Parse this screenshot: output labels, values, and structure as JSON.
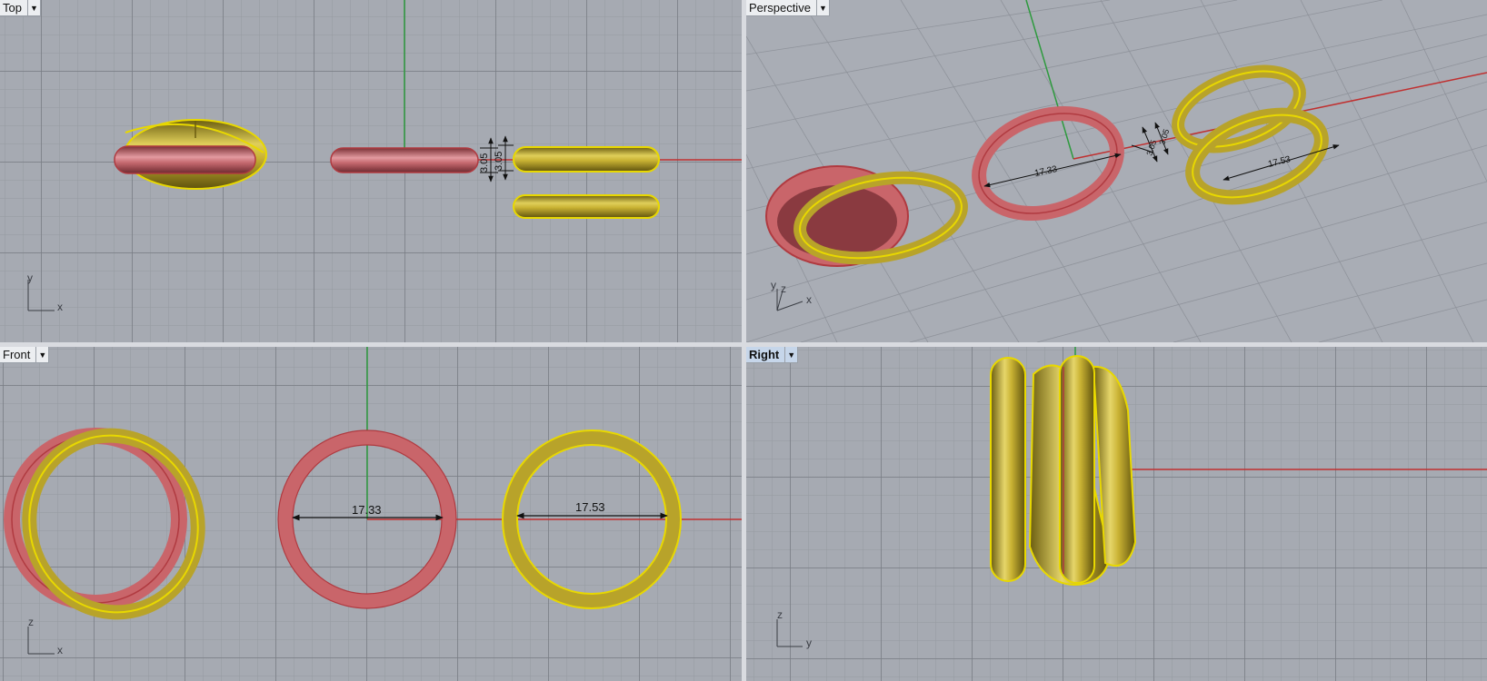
{
  "viewports": {
    "top": {
      "name": "Top",
      "active": false
    },
    "perspective": {
      "name": "Perspective",
      "active": false
    },
    "front": {
      "name": "Front",
      "active": false
    },
    "right": {
      "name": "Right",
      "active": true
    }
  },
  "dropdown_glyph": "▼",
  "dimensions": {
    "thickness_a": "3.05",
    "thickness_b": "3.05",
    "diameter_red": "17.33",
    "diameter_gold": "17.53",
    "persp_diameter_red": "17.33",
    "persp_diameter_gold": "17.53",
    "persp_thickness_a": "3.05",
    "persp_thickness_b": "3.05"
  },
  "axis_labels": {
    "top_x": "x",
    "top_y": "y",
    "persp_x": "x",
    "persp_y": "y",
    "persp_z": "z",
    "front_x": "x",
    "front_z": "z",
    "right_y": "y",
    "right_z": "z"
  },
  "colors": {
    "red_ring": "#c9656a",
    "gold_ring": "#b8a32a",
    "x_axis": "#c03030",
    "y_axis": "#2e9a3e",
    "selection_edge": "#e8d800"
  }
}
